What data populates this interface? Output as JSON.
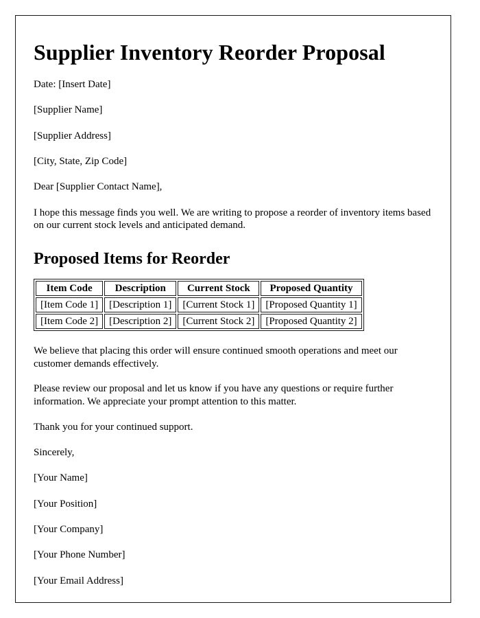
{
  "document": {
    "title": "Supplier Inventory Reorder Proposal",
    "date_line": "Date: [Insert Date]",
    "recipient": {
      "supplier_name": "[Supplier Name]",
      "supplier_address": "[Supplier Address]",
      "city_state_zip": "[City, State, Zip Code]"
    },
    "salutation": "Dear [Supplier Contact Name],",
    "intro_paragraph": "I hope this message finds you well. We are writing to propose a reorder of inventory items based on our current stock levels and anticipated demand.",
    "section_heading": "Proposed Items for Reorder",
    "table": {
      "headers": [
        "Item Code",
        "Description",
        "Current Stock",
        "Proposed Quantity"
      ],
      "rows": [
        [
          "[Item Code 1]",
          "[Description 1]",
          "[Current Stock 1]",
          "[Proposed Quantity 1]"
        ],
        [
          "[Item Code 2]",
          "[Description 2]",
          "[Current Stock 2]",
          "[Proposed Quantity 2]"
        ]
      ]
    },
    "body_paragraph_1": "We believe that placing this order will ensure continued smooth operations and meet our customer demands effectively.",
    "body_paragraph_2": "Please review our proposal and let us know if you have any questions or require further information. We appreciate your prompt attention to this matter.",
    "thanks_line": "Thank you for your continued support.",
    "closing": "Sincerely,",
    "signature": {
      "name": "[Your Name]",
      "position": "[Your Position]",
      "company": "[Your Company]",
      "phone": "[Your Phone Number]",
      "email": "[Your Email Address]"
    }
  },
  "colors": {
    "text": "#000000",
    "page_border": "#1a1a1a",
    "background": "#ffffff"
  }
}
